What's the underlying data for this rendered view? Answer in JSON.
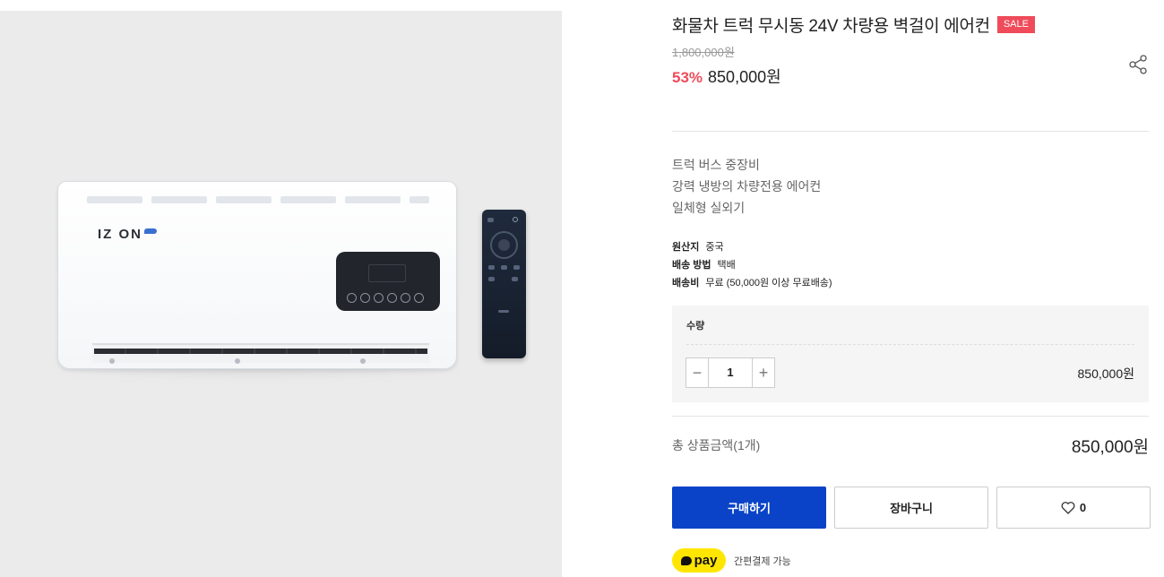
{
  "product": {
    "title": "화물차 트럭 무시동 24V 차량용 벽걸이 에어컨",
    "sale_badge": "SALE",
    "original_price": "1,800,000원",
    "discount": "53%",
    "sale_price": "850,000원",
    "image": {
      "brand_logo": "IZ ON",
      "illustration": "wall-mounted-air-conditioner-with-remote"
    }
  },
  "description": [
    "트럭 버스 중장비",
    "강력 냉방의 차량전용 에어컨",
    "일체형 실외기"
  ],
  "meta": [
    {
      "key": "원산지",
      "value": "중국"
    },
    {
      "key": "배송 방법",
      "value": "택배"
    },
    {
      "key": "배송비",
      "value": "무료 (50,000원 이상 무료배송)"
    }
  ],
  "quantity": {
    "label": "수량",
    "value": "1",
    "minus": "−",
    "plus": "+",
    "line_price": "850,000원"
  },
  "total": {
    "label": "총 상품금액(1개)",
    "price": "850,000원"
  },
  "buttons": {
    "buy": "구매하기",
    "cart": "장바구니",
    "wish_count": "0"
  },
  "pay": {
    "badge": "pay",
    "text": "간편결제 가능"
  },
  "icons": {
    "share": "share-icon",
    "heart": "heart-icon",
    "pay_bubble": "speech-bubble-icon"
  },
  "colors": {
    "accent_red": "#ef4b5a",
    "buy_blue": "#0a43c8",
    "kakao_yellow": "#ffe600"
  }
}
